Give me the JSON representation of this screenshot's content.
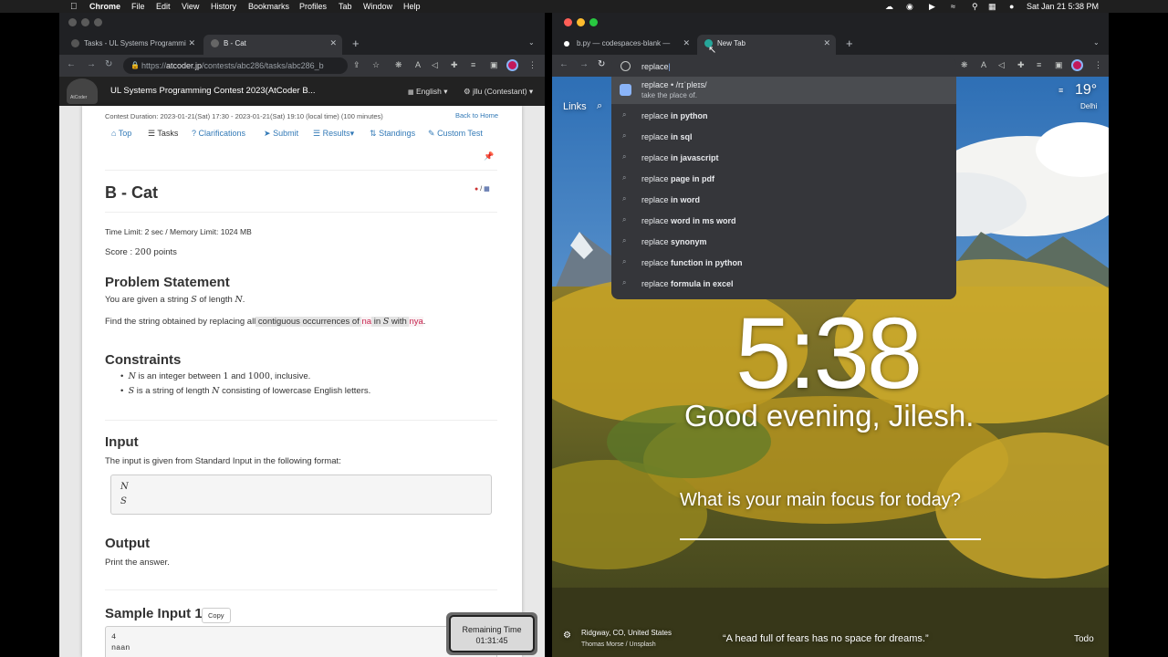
{
  "menubar": {
    "app": "Chrome",
    "items": [
      "File",
      "Edit",
      "View",
      "History",
      "Bookmarks",
      "Profiles",
      "Tab",
      "Window",
      "Help"
    ],
    "datetime": "Sat Jan 21  5:38 PM"
  },
  "left_window": {
    "tabs": [
      {
        "title": "Tasks - UL Systems Programmi"
      },
      {
        "title": "B - Cat"
      }
    ],
    "url_scheme": "https://",
    "url_host": "atcoder.jp",
    "url_path": "/contests/abc286/tasks/abc286_b",
    "header": {
      "contest_title": "UL Systems Programming Contest 2023(AtCoder B...",
      "logo_text": "AtCoder",
      "language": "English",
      "user": "jllu (Contestant)"
    },
    "contest_duration": "Contest Duration: 2023-01-21(Sat) 17:30 - 2023-01-21(Sat) 19:10 (local time) (100 minutes)",
    "back_home": "Back to Home",
    "nav": [
      "Top",
      "Tasks",
      "Clarifications",
      "Submit",
      "Results",
      "Standings",
      "Custom Test"
    ],
    "task_title": "B - Cat",
    "lang_switch": "/",
    "limits": "Time Limit: 2 sec / Memory Limit: 1024 MB",
    "score_label": "Score : ",
    "score_value": "200",
    "score_unit": " points",
    "problem_heading": "Problem Statement",
    "ps_line1_a": "You are given a string ",
    "ps_line1_S": "S",
    "ps_line1_b": " of length ",
    "ps_line1_N": "N",
    "ps_line1_c": ".",
    "ps_line2_a": "Find the string obtained by replacing all",
    "ps_line2_b": " contiguous occurrences of ",
    "ps_line2_na": "na",
    "ps_line2_in": " in ",
    "ps_line2_S": "S",
    "ps_line2_with": " with ",
    "ps_line2_nya": "nya",
    "ps_line2_end": ".",
    "constraints_heading": "Constraints",
    "c1_N": "N",
    "c1_a": " is an integer between ",
    "c1_1": "1",
    "c1_and": " and ",
    "c1_1000": "1000",
    "c1_b": ", inclusive.",
    "c2_S": "S",
    "c2_a": " is a string of length ",
    "c2_N": "N",
    "c2_b": " consisting of lowercase English letters.",
    "input_heading": "Input",
    "input_text": "The input is given from Standard Input in the following format:",
    "input_fmt_1": "N",
    "input_fmt_2": "S",
    "output_heading": "Output",
    "output_text": "Print the answer.",
    "sample_heading": "Sample Input 1",
    "copy_label": "Copy",
    "sample_line1": "4",
    "sample_line2": "naan",
    "timer_label": "Remaining Time",
    "timer_value": "01:31:45"
  },
  "right_window": {
    "tabs": [
      {
        "title": "b.py — codespaces-blank —"
      },
      {
        "title": "New Tab"
      }
    ],
    "omnibox_value": "replace",
    "suggestions": [
      {
        "prefix": "replace",
        "rest": " • /rɪˈpleɪs/",
        "sub": "take the place of."
      },
      {
        "prefix": "replace",
        "rest": " in python"
      },
      {
        "prefix": "replace",
        "rest": " in sql"
      },
      {
        "prefix": "replace",
        "rest": " in javascript"
      },
      {
        "prefix": "replace",
        "rest": " page in pdf"
      },
      {
        "prefix": "replace",
        "rest": " in word"
      },
      {
        "prefix": "replace",
        "rest": " word in ms word"
      },
      {
        "prefix": "replace",
        "rest": " synonym"
      },
      {
        "prefix": "replace",
        "rest": " function in python"
      },
      {
        "prefix": "replace",
        "rest": " formula in excel"
      }
    ],
    "momentum": {
      "links": "Links",
      "temperature": "19°",
      "city": "Delhi",
      "time": "5:38",
      "greeting": "Good evening, Jilesh.",
      "focus_prompt": "What is your main focus for today?",
      "location": "Ridgway, CO, United States",
      "photo_credit": "Thomas Morse / Unsplash",
      "quote": "“A head full of fears has no space for dreams.”",
      "todo": "Todo"
    }
  },
  "colors": {
    "chrome_dark": "#202124",
    "chrome_toolbar": "#35363a",
    "atcoder_link": "#337ab7",
    "atcoder_code": "#c7254e"
  }
}
